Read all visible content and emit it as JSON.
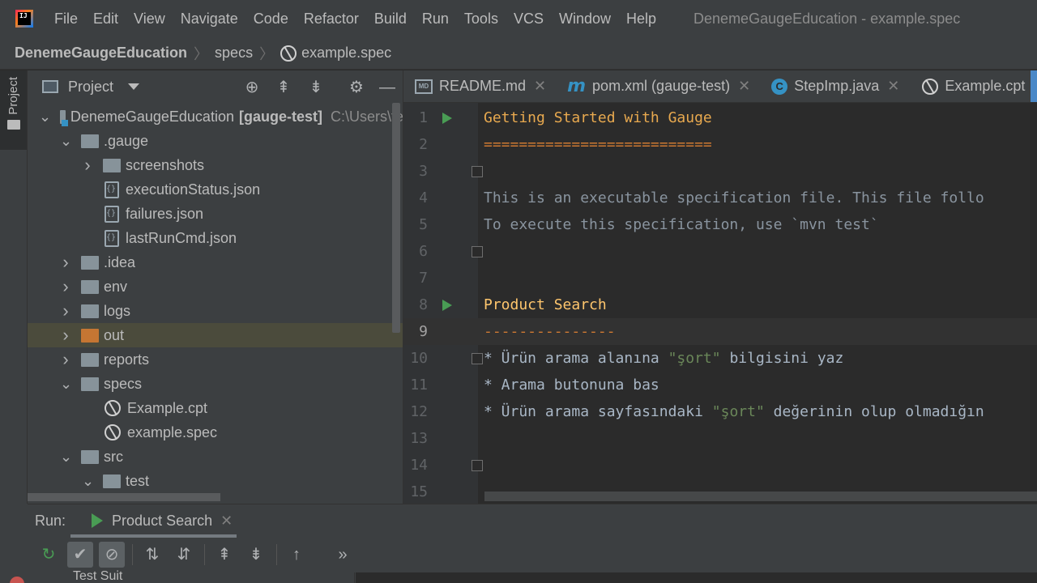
{
  "app": {
    "logo_text": "IJ",
    "window_title": "DenemeGaugeEducation - example.spec"
  },
  "menu": {
    "items": [
      "File",
      "Edit",
      "View",
      "Navigate",
      "Code",
      "Refactor",
      "Build",
      "Run",
      "Tools",
      "VCS",
      "Window",
      "Help"
    ]
  },
  "breadcrumb": {
    "project": "DenemeGaugeEducation",
    "folder": "specs",
    "file": "example.spec"
  },
  "left_stripe": {
    "project_tab": "Project"
  },
  "project_panel": {
    "title": "Project",
    "tree": [
      {
        "label": "DenemeGaugeEducation",
        "module": "[gauge-test]",
        "path": "C:\\Users\\te",
        "arrow": "down",
        "icon": "module-folder"
      },
      {
        "label": ".gauge",
        "arrow": "down",
        "icon": "folder"
      },
      {
        "label": "screenshots",
        "arrow": "right",
        "icon": "folder"
      },
      {
        "label": "executionStatus.json",
        "arrow": "none",
        "icon": "json"
      },
      {
        "label": "failures.json",
        "arrow": "none",
        "icon": "json"
      },
      {
        "label": "lastRunCmd.json",
        "arrow": "none",
        "icon": "json"
      },
      {
        "label": ".idea",
        "arrow": "right",
        "icon": "folder"
      },
      {
        "label": "env",
        "arrow": "right",
        "icon": "folder"
      },
      {
        "label": "logs",
        "arrow": "right",
        "icon": "folder"
      },
      {
        "label": "out",
        "arrow": "right",
        "icon": "folder-orange",
        "selected": true
      },
      {
        "label": "reports",
        "arrow": "right",
        "icon": "folder"
      },
      {
        "label": "specs",
        "arrow": "down",
        "icon": "folder"
      },
      {
        "label": "Example.cpt",
        "arrow": "none",
        "icon": "gauge"
      },
      {
        "label": "example.spec",
        "arrow": "none",
        "icon": "gauge"
      },
      {
        "label": "src",
        "arrow": "down",
        "icon": "folder"
      },
      {
        "label": "test",
        "arrow": "down",
        "icon": "folder"
      }
    ]
  },
  "editor_tabs": [
    {
      "label": "README.md",
      "icon": "md-icon",
      "active": false
    },
    {
      "label": "pom.xml (gauge-test)",
      "icon": "maven-icon",
      "active": false
    },
    {
      "label": "StepImp.java",
      "icon": "class-icon",
      "active": false
    },
    {
      "label": "Example.cpt",
      "icon": "gauge-icon",
      "active": false
    }
  ],
  "editor": {
    "current_line": 9,
    "lines": [
      {
        "n": "1",
        "text": "Getting Started with Gauge",
        "style": "heading",
        "run": true
      },
      {
        "n": "2",
        "text": "==========================",
        "style": "under"
      },
      {
        "n": "3",
        "text": "",
        "fold": true
      },
      {
        "n": "4",
        "text": "This is an executable specification file. This file follo",
        "style": "comment"
      },
      {
        "n": "5",
        "text": "To execute this specification, use `mvn test`",
        "style": "comment"
      },
      {
        "n": "6",
        "text": "",
        "fold": true
      },
      {
        "n": "7",
        "text": ""
      },
      {
        "n": "8",
        "text": "Product Search",
        "style": "heading2",
        "run": true
      },
      {
        "n": "9",
        "text": "---------------",
        "style": "under"
      },
      {
        "n": "10",
        "pre": "* Ürün arama alanına ",
        "str": "\"şort\"",
        "post": " bilgisini yaz",
        "style": "step",
        "fold": true
      },
      {
        "n": "11",
        "pre": "* Arama butonuna bas",
        "str": "",
        "post": "",
        "style": "step"
      },
      {
        "n": "12",
        "pre": "* Ürün arama sayfasındaki ",
        "str": "\"şort\"",
        "post": " değerinin olup olmadığın",
        "style": "step"
      },
      {
        "n": "13",
        "text": ""
      },
      {
        "n": "14",
        "text": "",
        "fold": true
      },
      {
        "n": "15",
        "text": ""
      }
    ]
  },
  "run_panel": {
    "label": "Run:",
    "tab": "Product Search",
    "bottom_text": "Test Suit"
  },
  "colors": {
    "accent": "#4a88c7",
    "run_green": "#499c54",
    "selection": "#4b4b3c"
  }
}
